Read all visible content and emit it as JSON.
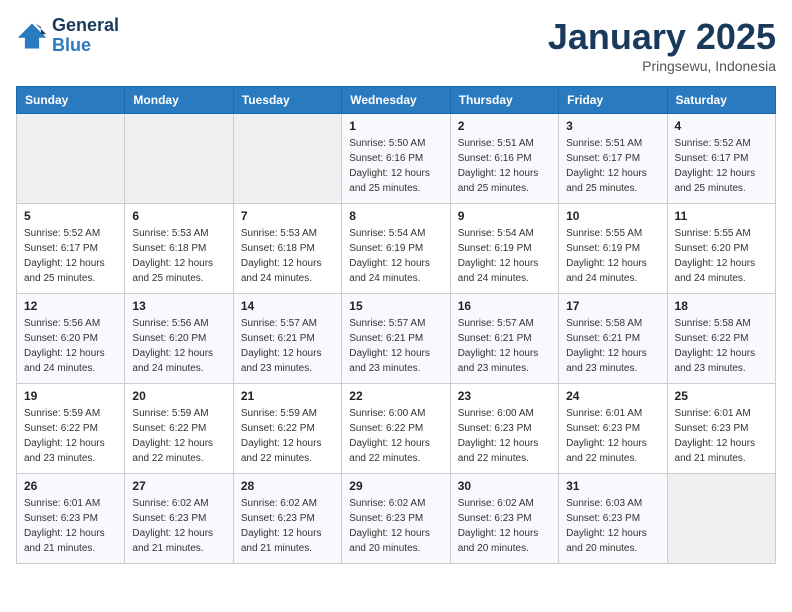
{
  "header": {
    "logo_line1": "General",
    "logo_line2": "Blue",
    "title": "January 2025",
    "subtitle": "Pringsewu, Indonesia"
  },
  "weekdays": [
    "Sunday",
    "Monday",
    "Tuesday",
    "Wednesday",
    "Thursday",
    "Friday",
    "Saturday"
  ],
  "weeks": [
    [
      {
        "day": "",
        "info": ""
      },
      {
        "day": "",
        "info": ""
      },
      {
        "day": "",
        "info": ""
      },
      {
        "day": "1",
        "info": "Sunrise: 5:50 AM\nSunset: 6:16 PM\nDaylight: 12 hours\nand 25 minutes."
      },
      {
        "day": "2",
        "info": "Sunrise: 5:51 AM\nSunset: 6:16 PM\nDaylight: 12 hours\nand 25 minutes."
      },
      {
        "day": "3",
        "info": "Sunrise: 5:51 AM\nSunset: 6:17 PM\nDaylight: 12 hours\nand 25 minutes."
      },
      {
        "day": "4",
        "info": "Sunrise: 5:52 AM\nSunset: 6:17 PM\nDaylight: 12 hours\nand 25 minutes."
      }
    ],
    [
      {
        "day": "5",
        "info": "Sunrise: 5:52 AM\nSunset: 6:17 PM\nDaylight: 12 hours\nand 25 minutes."
      },
      {
        "day": "6",
        "info": "Sunrise: 5:53 AM\nSunset: 6:18 PM\nDaylight: 12 hours\nand 25 minutes."
      },
      {
        "day": "7",
        "info": "Sunrise: 5:53 AM\nSunset: 6:18 PM\nDaylight: 12 hours\nand 24 minutes."
      },
      {
        "day": "8",
        "info": "Sunrise: 5:54 AM\nSunset: 6:19 PM\nDaylight: 12 hours\nand 24 minutes."
      },
      {
        "day": "9",
        "info": "Sunrise: 5:54 AM\nSunset: 6:19 PM\nDaylight: 12 hours\nand 24 minutes."
      },
      {
        "day": "10",
        "info": "Sunrise: 5:55 AM\nSunset: 6:19 PM\nDaylight: 12 hours\nand 24 minutes."
      },
      {
        "day": "11",
        "info": "Sunrise: 5:55 AM\nSunset: 6:20 PM\nDaylight: 12 hours\nand 24 minutes."
      }
    ],
    [
      {
        "day": "12",
        "info": "Sunrise: 5:56 AM\nSunset: 6:20 PM\nDaylight: 12 hours\nand 24 minutes."
      },
      {
        "day": "13",
        "info": "Sunrise: 5:56 AM\nSunset: 6:20 PM\nDaylight: 12 hours\nand 24 minutes."
      },
      {
        "day": "14",
        "info": "Sunrise: 5:57 AM\nSunset: 6:21 PM\nDaylight: 12 hours\nand 23 minutes."
      },
      {
        "day": "15",
        "info": "Sunrise: 5:57 AM\nSunset: 6:21 PM\nDaylight: 12 hours\nand 23 minutes."
      },
      {
        "day": "16",
        "info": "Sunrise: 5:57 AM\nSunset: 6:21 PM\nDaylight: 12 hours\nand 23 minutes."
      },
      {
        "day": "17",
        "info": "Sunrise: 5:58 AM\nSunset: 6:21 PM\nDaylight: 12 hours\nand 23 minutes."
      },
      {
        "day": "18",
        "info": "Sunrise: 5:58 AM\nSunset: 6:22 PM\nDaylight: 12 hours\nand 23 minutes."
      }
    ],
    [
      {
        "day": "19",
        "info": "Sunrise: 5:59 AM\nSunset: 6:22 PM\nDaylight: 12 hours\nand 23 minutes."
      },
      {
        "day": "20",
        "info": "Sunrise: 5:59 AM\nSunset: 6:22 PM\nDaylight: 12 hours\nand 22 minutes."
      },
      {
        "day": "21",
        "info": "Sunrise: 5:59 AM\nSunset: 6:22 PM\nDaylight: 12 hours\nand 22 minutes."
      },
      {
        "day": "22",
        "info": "Sunrise: 6:00 AM\nSunset: 6:22 PM\nDaylight: 12 hours\nand 22 minutes."
      },
      {
        "day": "23",
        "info": "Sunrise: 6:00 AM\nSunset: 6:23 PM\nDaylight: 12 hours\nand 22 minutes."
      },
      {
        "day": "24",
        "info": "Sunrise: 6:01 AM\nSunset: 6:23 PM\nDaylight: 12 hours\nand 22 minutes."
      },
      {
        "day": "25",
        "info": "Sunrise: 6:01 AM\nSunset: 6:23 PM\nDaylight: 12 hours\nand 21 minutes."
      }
    ],
    [
      {
        "day": "26",
        "info": "Sunrise: 6:01 AM\nSunset: 6:23 PM\nDaylight: 12 hours\nand 21 minutes."
      },
      {
        "day": "27",
        "info": "Sunrise: 6:02 AM\nSunset: 6:23 PM\nDaylight: 12 hours\nand 21 minutes."
      },
      {
        "day": "28",
        "info": "Sunrise: 6:02 AM\nSunset: 6:23 PM\nDaylight: 12 hours\nand 21 minutes."
      },
      {
        "day": "29",
        "info": "Sunrise: 6:02 AM\nSunset: 6:23 PM\nDaylight: 12 hours\nand 20 minutes."
      },
      {
        "day": "30",
        "info": "Sunrise: 6:02 AM\nSunset: 6:23 PM\nDaylight: 12 hours\nand 20 minutes."
      },
      {
        "day": "31",
        "info": "Sunrise: 6:03 AM\nSunset: 6:23 PM\nDaylight: 12 hours\nand 20 minutes."
      },
      {
        "day": "",
        "info": ""
      }
    ]
  ]
}
